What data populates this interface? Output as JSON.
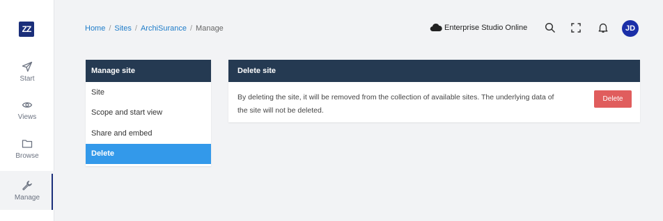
{
  "app": {
    "logo_text": "ZZ",
    "brand_color": "#1b2f7a"
  },
  "sidebar": {
    "items": [
      {
        "label": "Start",
        "icon": "send-icon"
      },
      {
        "label": "Views",
        "icon": "eye-icon"
      },
      {
        "label": "Browse",
        "icon": "folder-icon"
      },
      {
        "label": "Manage",
        "icon": "wrench-icon",
        "active": true
      }
    ]
  },
  "breadcrumb": {
    "items": [
      "Home",
      "Sites",
      "ArchiSurance",
      "Manage"
    ],
    "separator": "/"
  },
  "header": {
    "studio_label": "Enterprise Studio Online",
    "avatar_initials": "JD"
  },
  "manage_site": {
    "title": "Manage site",
    "items": [
      "Site",
      "Scope and start view",
      "Share and embed",
      "Delete"
    ],
    "active_index": 3
  },
  "delete_site": {
    "title": "Delete site",
    "description": "By deleting the site, it will be removed from the collection of available sites. The underlying data of the site will not be deleted.",
    "button_label": "Delete",
    "button_color": "#e05d5d"
  }
}
